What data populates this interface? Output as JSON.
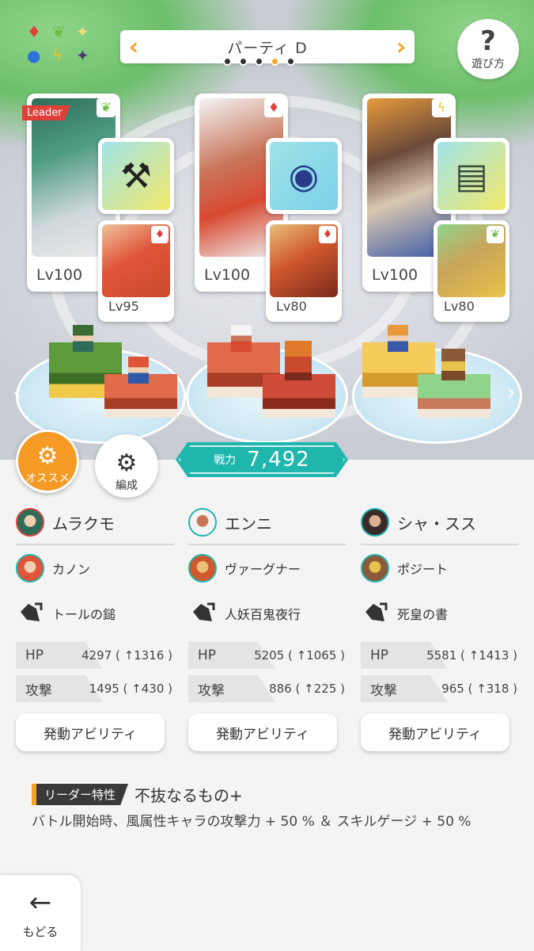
{
  "header": {
    "party_title": "パーティ D",
    "page_count": 5,
    "active_page": 4,
    "help_label": "遊び方"
  },
  "attribute_filter_icons": [
    "diamond-icon",
    "leaf-icon",
    "sparkle-icon",
    "water-icon",
    "lightning-icon",
    "dark-star-icon"
  ],
  "leader_tag": "Leader",
  "slots": [
    {
      "main": {
        "level": "Lv100",
        "attribute": "wind",
        "name": "ムラクモ"
      },
      "item": {
        "name": "トールの鎚",
        "icon": "hammer-icon"
      },
      "sub": {
        "level": "Lv95",
        "attribute": "fire",
        "name": "カノン"
      },
      "hp": {
        "label": "HP",
        "value": "4297 ( ↑1316 )"
      },
      "atk": {
        "label": "攻撃",
        "value": "1495 ( ↑430 )"
      }
    },
    {
      "main": {
        "level": "Lv100",
        "attribute": "fire",
        "name": "エンニ"
      },
      "item": {
        "name": "人妖百鬼夜行",
        "icon": "orb-icon"
      },
      "sub": {
        "level": "Lv80",
        "attribute": "fire",
        "name": "ヴァーグナー"
      },
      "hp": {
        "label": "HP",
        "value": "5205 ( ↑1065 )"
      },
      "atk": {
        "label": "攻撃",
        "value": "886 ( ↑225 )"
      }
    },
    {
      "main": {
        "level": "Lv100",
        "attribute": "lightning",
        "name": "シャ・スス"
      },
      "item": {
        "name": "死皇の書",
        "icon": "book-icon"
      },
      "sub": {
        "level": "Lv80",
        "attribute": "wind",
        "name": "ポジート"
      },
      "hp": {
        "label": "HP",
        "value": "5581 ( ↑1413 )"
      },
      "atk": {
        "label": "攻撃",
        "value": "965 ( ↑318 )"
      }
    }
  ],
  "buttons": {
    "recommend": "オススメ",
    "edit": "編成",
    "ability": "発動アビリティ",
    "back": "もどる"
  },
  "power": {
    "label": "戦力",
    "value": "7,492"
  },
  "leader_skill": {
    "tag": "リーダー特性",
    "name": "不抜なるもの+",
    "description": "バトル開始時、風属性キャラの攻撃力 + 50 % ＆ スキルゲージ + 50 %"
  },
  "colors": {
    "accent": "#f5a425",
    "power": "#1fb6ad",
    "fire": "#e0403a",
    "wind": "#6abf3e",
    "lightning": "#f2c31c"
  }
}
